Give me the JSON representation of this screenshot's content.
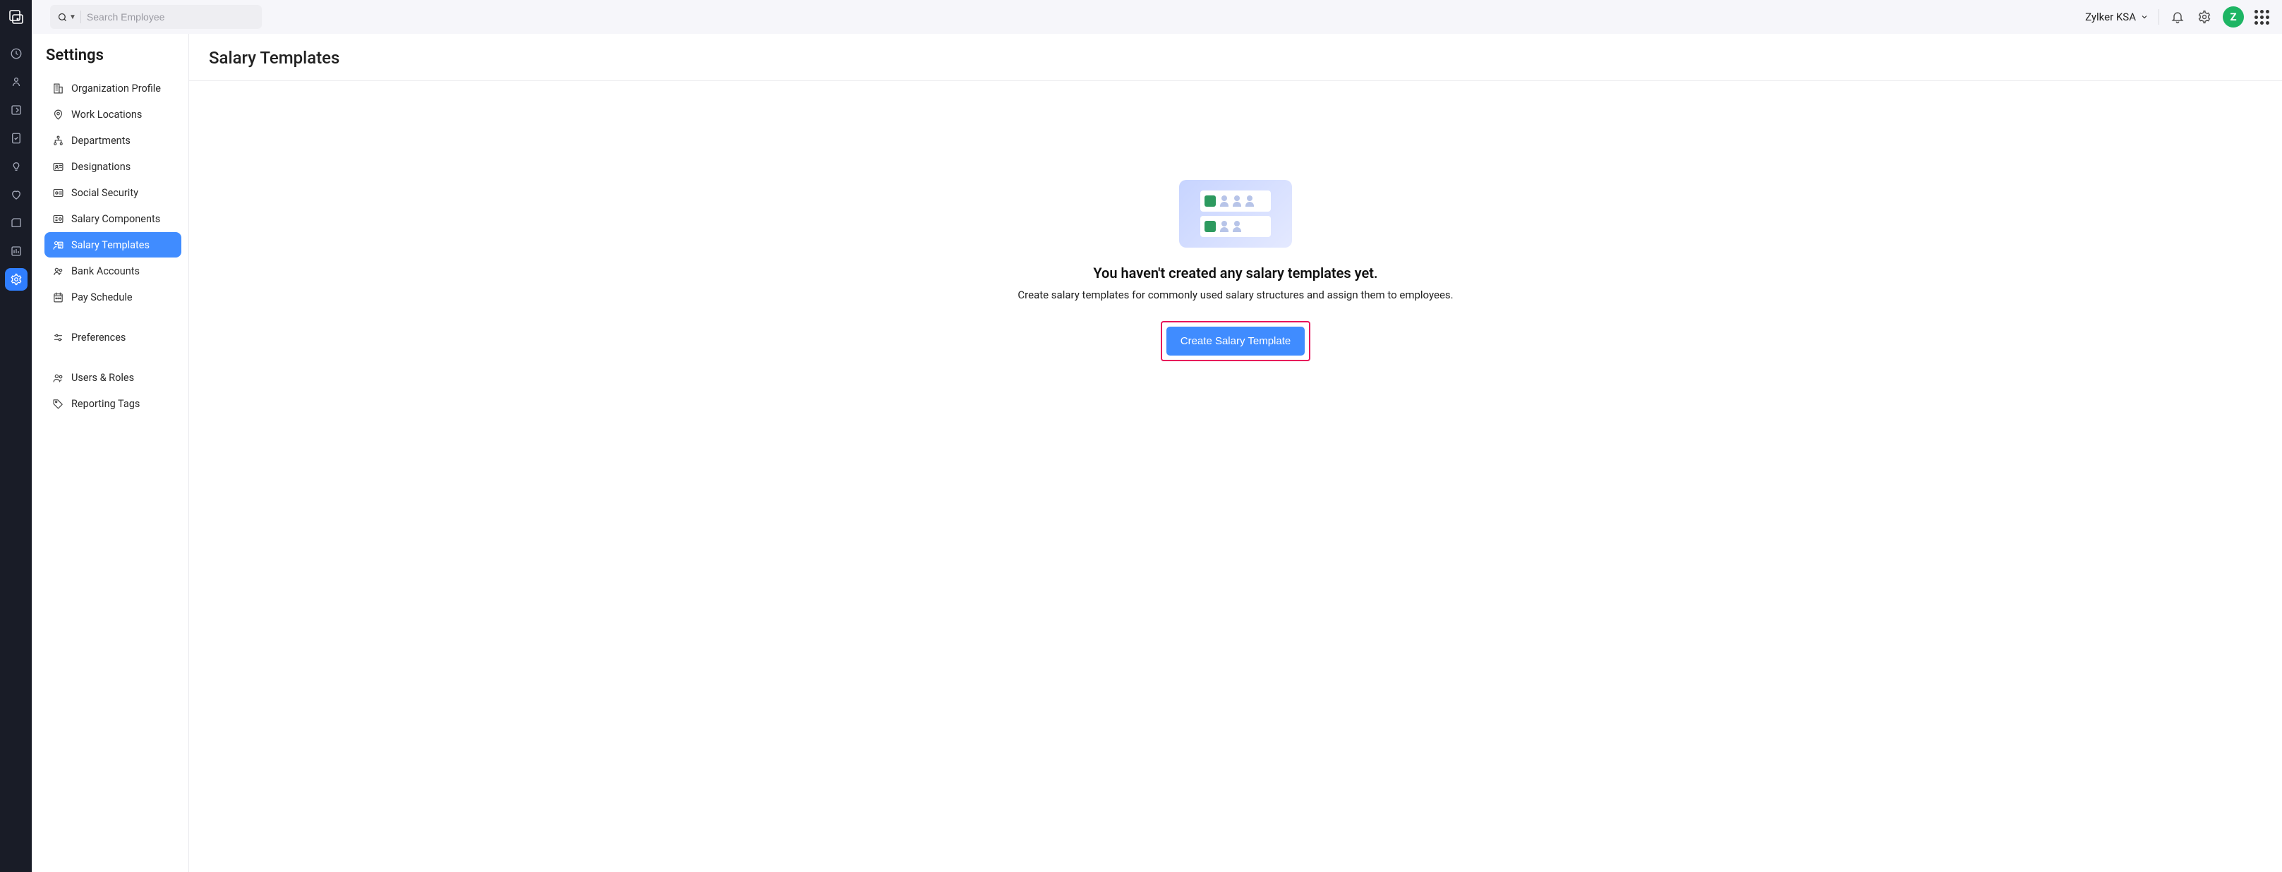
{
  "topbar": {
    "search_placeholder": "Search Employee",
    "org_name": "Zylker KSA",
    "avatar_letter": "Z"
  },
  "settings": {
    "title": "Settings",
    "items": [
      {
        "label": "Organization Profile",
        "icon": "building"
      },
      {
        "label": "Work Locations",
        "icon": "location"
      },
      {
        "label": "Departments",
        "icon": "org-tree"
      },
      {
        "label": "Designations",
        "icon": "id-card"
      },
      {
        "label": "Social Security",
        "icon": "shield-id"
      },
      {
        "label": "Salary Components",
        "icon": "money-list"
      },
      {
        "label": "Salary Templates",
        "icon": "user-template"
      },
      {
        "label": "Bank Accounts",
        "icon": "users-small"
      },
      {
        "label": "Pay Schedule",
        "icon": "calendar-check"
      }
    ],
    "items2": [
      {
        "label": "Preferences",
        "icon": "sliders"
      }
    ],
    "items3": [
      {
        "label": "Users & Roles",
        "icon": "users"
      },
      {
        "label": "Reporting Tags",
        "icon": "tag"
      }
    ],
    "active_index": 6
  },
  "content": {
    "title": "Salary Templates",
    "empty_heading": "You haven't created any salary templates yet.",
    "empty_sub": "Create salary templates for commonly used salary structures and assign them to employees.",
    "cta_label": "Create Salary Template"
  },
  "colors": {
    "accent": "#408cff",
    "highlight_border": "#e7145a"
  }
}
